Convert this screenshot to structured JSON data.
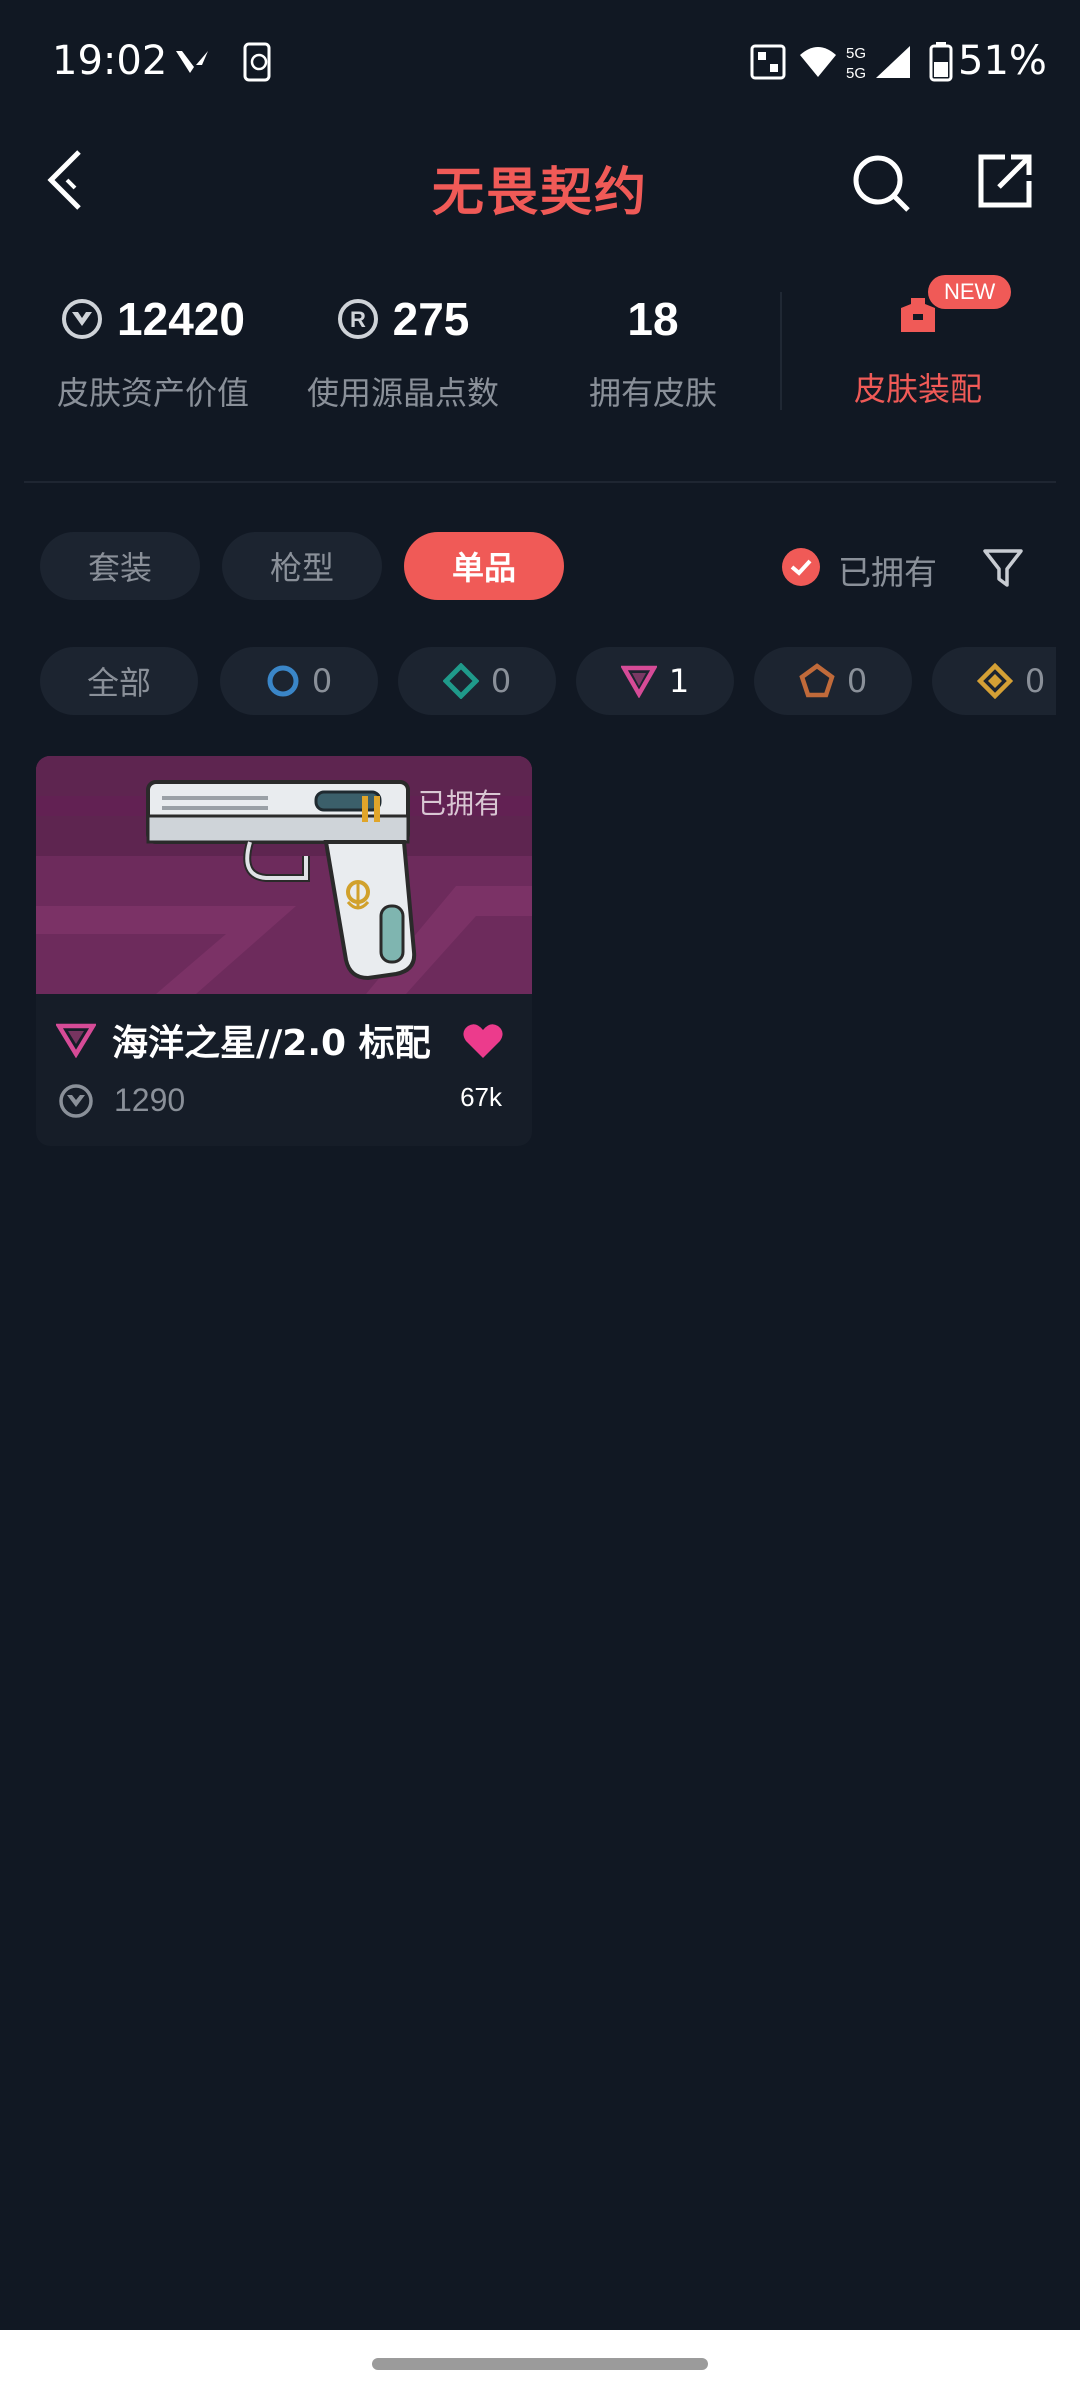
{
  "status_bar": {
    "time": "19:02",
    "battery": "51%",
    "icons": [
      "valorant-icon",
      "phone-sync-icon",
      "nfc-icon",
      "wifi-icon",
      "signal-5g-icon",
      "battery-icon"
    ]
  },
  "header": {
    "title": "无畏契约",
    "back_icon": "back-chevron-icon",
    "search_icon": "search-icon",
    "share_icon": "share-icon"
  },
  "stats": [
    {
      "value": "12420",
      "label": "皮肤资产价值",
      "icon": "vp-coin-icon"
    },
    {
      "value": "275",
      "label": "使用源晶点数",
      "icon": "radianite-icon"
    },
    {
      "value": "18",
      "label": "拥有皮肤"
    }
  ],
  "outfit": {
    "label": "皮肤装配",
    "badge": "NEW",
    "icon": "outfit-icon"
  },
  "tabs": [
    {
      "label": "套装",
      "active": false
    },
    {
      "label": "枪型",
      "active": false
    },
    {
      "label": "单品",
      "active": true
    }
  ],
  "owned_filter": {
    "label": "已拥有",
    "checked": true
  },
  "tiers": [
    {
      "label": "全部"
    },
    {
      "icon": "select-tier-icon",
      "count": "0",
      "color": "#3a86c8"
    },
    {
      "icon": "deluxe-tier-icon",
      "count": "0",
      "color": "#1f9a8a"
    },
    {
      "icon": "premium-tier-icon",
      "count": "1",
      "color": "#d64b97"
    },
    {
      "icon": "exclusive-tier-icon",
      "count": "0",
      "color": "#c06a3a"
    },
    {
      "icon": "ultra-tier-icon",
      "count": "0",
      "color": "#d4a035"
    }
  ],
  "card": {
    "owned_label": "已拥有",
    "name": "海洋之星//2.0 标配",
    "price": "1290",
    "likes": "67k",
    "tier_icon": "premium-tier-icon",
    "image": "pistol-skin-image"
  },
  "colors": {
    "accent": "#f05a57",
    "background": "#111823"
  }
}
